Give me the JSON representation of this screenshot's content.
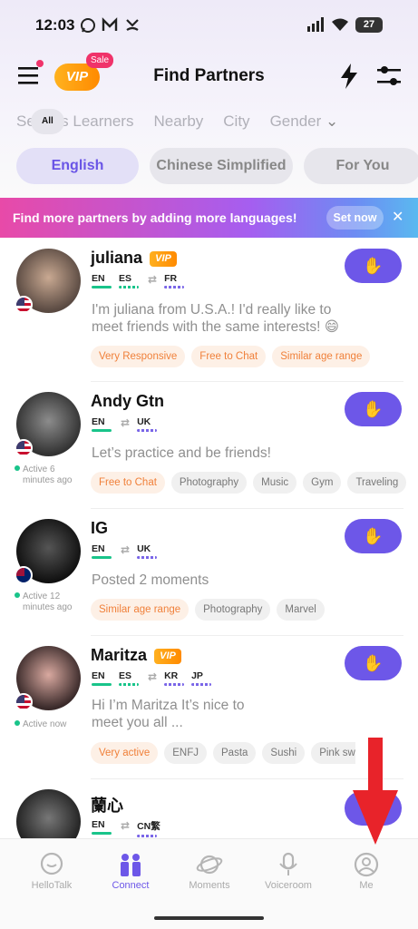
{
  "status": {
    "time": "12:03",
    "battery": "27"
  },
  "header": {
    "title": "Find Partners",
    "vip_label": "VIP",
    "sale_label": "Sale"
  },
  "tabs": [
    "All",
    "Serious Learners",
    "Nearby",
    "City",
    "Gender"
  ],
  "language_chips": [
    "English",
    "Chinese Simplified",
    "For You"
  ],
  "banner": {
    "text": "Find more partners by adding more languages!",
    "button": "Set now"
  },
  "users": [
    {
      "name": "juliana",
      "vip": true,
      "native": [
        "EN",
        "ES"
      ],
      "learning": [
        "FR"
      ],
      "bio": "I'm juliana from U.S.A.! I'd really like to meet friends with the same interests! 😄",
      "status": "",
      "tags": [
        "Very Responsive",
        "Free to Chat",
        "Similar age range"
      ]
    },
    {
      "name": "Andy Gtn",
      "vip": false,
      "native": [
        "EN"
      ],
      "learning": [
        "UK"
      ],
      "bio": "Let’s practice and be friends!",
      "status": "Active 6 minutes ago",
      "tags": [
        "Free to Chat",
        "Photography",
        "Music",
        "Gym",
        "Traveling"
      ]
    },
    {
      "name": "IG",
      "vip": false,
      "native": [
        "EN"
      ],
      "learning": [
        "UK"
      ],
      "bio": "Posted 2 moments",
      "status": "Active 12 minutes ago",
      "tags": [
        "Similar age range",
        "Photography",
        "Marvel"
      ]
    },
    {
      "name": "Maritza",
      "vip": true,
      "native": [
        "EN",
        "ES"
      ],
      "learning": [
        "KR",
        "JP"
      ],
      "bio": "Hi I’m Maritza It’s nice to meet you all ...",
      "status": "Active now",
      "tags": [
        "Very active",
        "ENFJ",
        "Pasta",
        "Sushi",
        "Pink swea"
      ]
    },
    {
      "name": "蘭心",
      "vip": false,
      "native": [
        "EN"
      ],
      "learning": [
        "CN繁"
      ],
      "bio": "",
      "status": "",
      "tags": []
    }
  ],
  "bottom_nav": [
    "HelloTalk",
    "Connect",
    "Moments",
    "Voiceroom",
    "Me"
  ],
  "colors": {
    "accent": "#6d57e8",
    "highlight": "#e8232a"
  }
}
